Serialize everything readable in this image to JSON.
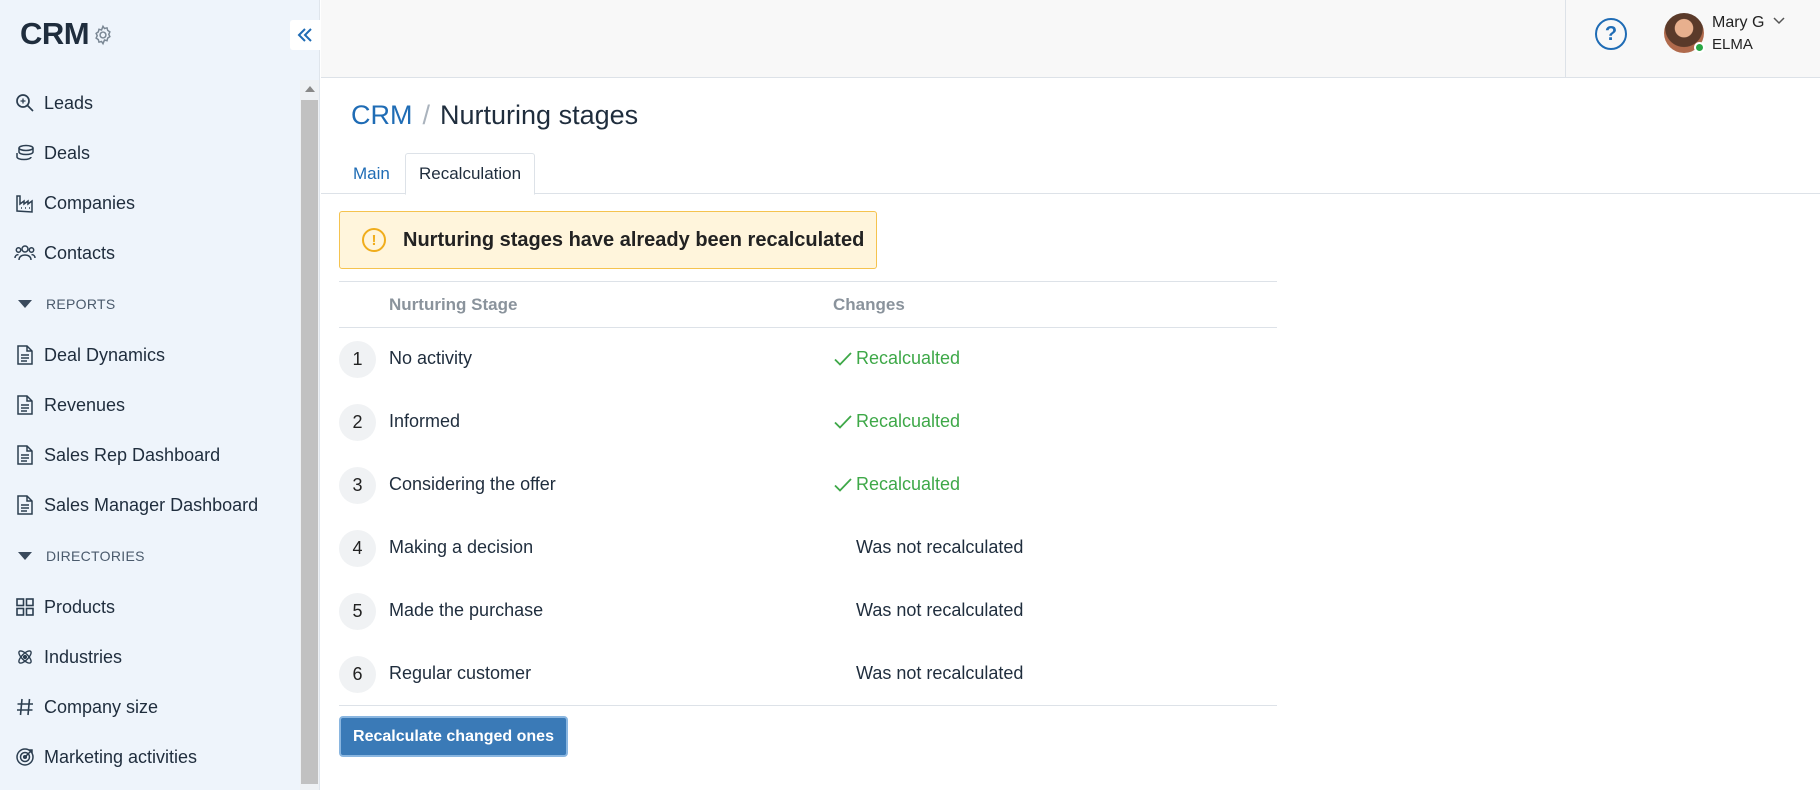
{
  "app": {
    "title": "CRM"
  },
  "sidebar": {
    "items_top": [
      {
        "label": "Leads",
        "icon": "search-icon"
      },
      {
        "label": "Deals",
        "icon": "coins-icon"
      },
      {
        "label": "Companies",
        "icon": "factory-icon"
      },
      {
        "label": "Contacts",
        "icon": "users-icon"
      }
    ],
    "reports_label": "REPORTS",
    "reports": [
      {
        "label": "Deal Dynamics",
        "icon": "document-icon"
      },
      {
        "label": "Revenues",
        "icon": "document-icon"
      },
      {
        "label": "Sales Rep Dashboard",
        "icon": "document-icon"
      },
      {
        "label": "Sales Manager Dashboard",
        "icon": "document-icon"
      }
    ],
    "directories_label": "DIRECTORIES",
    "directories": [
      {
        "label": "Products",
        "icon": "grid-icon"
      },
      {
        "label": "Industries",
        "icon": "atom-icon"
      },
      {
        "label": "Company size",
        "icon": "hash-icon"
      },
      {
        "label": "Marketing activities",
        "icon": "target-icon"
      }
    ]
  },
  "header": {
    "user": {
      "name": "Mary G",
      "org": "ELMA",
      "status": "online"
    },
    "help_icon": "question-circle-icon"
  },
  "breadcrumb": {
    "root": "CRM",
    "separator": "/",
    "page": "Nurturing stages"
  },
  "tabs": [
    {
      "label": "Main",
      "active": false
    },
    {
      "label": "Recalculation",
      "active": true
    }
  ],
  "alert": {
    "text": "Nurturing stages have already been recalculated",
    "type": "warning"
  },
  "table": {
    "headers": {
      "stage": "Nurturing Stage",
      "changes": "Changes"
    },
    "rows": [
      {
        "num": "1",
        "stage": "No activity",
        "change": "Recalcualted",
        "status": "ok"
      },
      {
        "num": "2",
        "stage": "Informed",
        "change": "Recalcualted",
        "status": "ok"
      },
      {
        "num": "3",
        "stage": "Considering the offer",
        "change": "Recalcualted",
        "status": "ok"
      },
      {
        "num": "4",
        "stage": "Making a decision",
        "change": "Was not recalculated",
        "status": "not"
      },
      {
        "num": "5",
        "stage": "Made the purchase",
        "change": "Was not recalculated",
        "status": "not"
      },
      {
        "num": "6",
        "stage": "Regular customer",
        "change": "Was not recalculated",
        "status": "not"
      }
    ]
  },
  "actions": {
    "recalculate_label": "Recalculate changed ones"
  },
  "colors": {
    "accent": "#1f6cb5",
    "success": "#3ea848",
    "warning_bg": "#fff5dc",
    "warning_border": "#f5c34f",
    "button": "#3a7ab7"
  }
}
